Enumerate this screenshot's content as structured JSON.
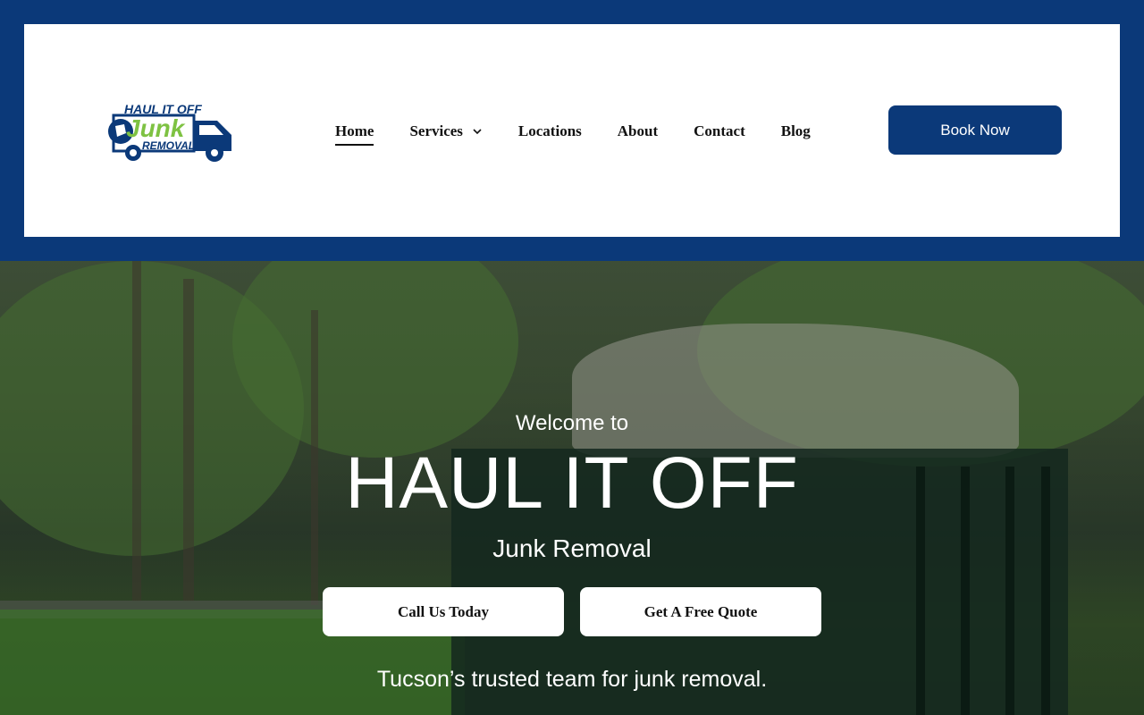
{
  "header": {
    "logo": {
      "line1": "HAUL IT OFF",
      "line2": "Junk",
      "line3": "REMOVAL",
      "colors": {
        "blue": "#0b3979",
        "green": "#7ec242"
      }
    },
    "nav": [
      {
        "label": "Home",
        "active": true
      },
      {
        "label": "Services",
        "has_dropdown": true
      },
      {
        "label": "Locations"
      },
      {
        "label": "About"
      },
      {
        "label": "Contact"
      },
      {
        "label": "Blog"
      }
    ],
    "book_label": "Book Now"
  },
  "hero": {
    "welcome": "Welcome to",
    "title": "HAUL IT OFF",
    "subtitle": "Junk Removal",
    "cta_call": "Call Us Today",
    "cta_quote": "Get A Free Quote",
    "tagline": "Tucson’s trusted team for junk removal."
  },
  "colors": {
    "brand_blue": "#0b3979",
    "white": "#ffffff"
  },
  "icons": {
    "services_dropdown": "chevron-down-icon"
  }
}
